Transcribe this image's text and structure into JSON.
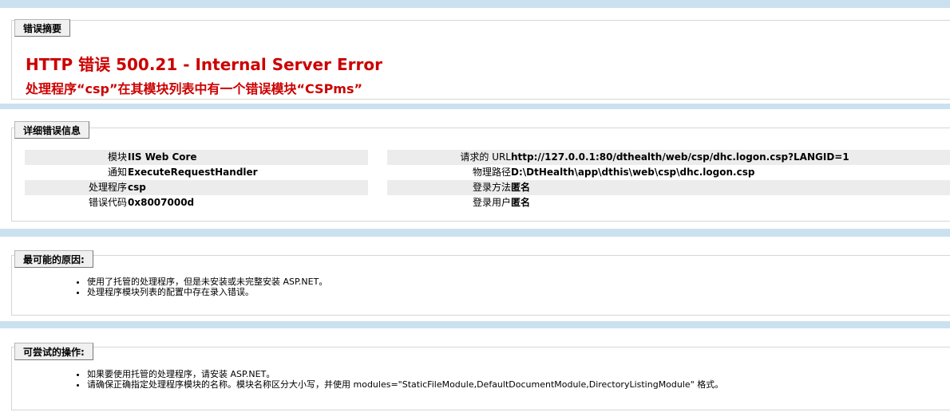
{
  "summary": {
    "legend": "错误摘要",
    "title": "HTTP 错误 500.21 - Internal Server Error",
    "subtitle": "处理程序“csp”在其模块列表中有一个错误模块“CSPms”"
  },
  "details": {
    "legend": "详细错误信息",
    "left": [
      {
        "label": "模块",
        "value": "IIS Web Core"
      },
      {
        "label": "通知",
        "value": "ExecuteRequestHandler"
      },
      {
        "label": "处理程序",
        "value": "csp"
      },
      {
        "label": "错误代码",
        "value": "0x8007000d"
      }
    ],
    "right": [
      {
        "label": "请求的 URL",
        "value": "http://127.0.0.1:80/dthealth/web/csp/dhc.logon.csp?LANGID=1"
      },
      {
        "label": "物理路径",
        "value": "D:\\DtHealth\\app\\dthis\\web\\csp\\dhc.logon.csp"
      },
      {
        "label": "登录方法",
        "value": "匿名"
      },
      {
        "label": "登录用户",
        "value": "匿名"
      }
    ]
  },
  "causes": {
    "legend": "最可能的原因:",
    "items": [
      "使用了托管的处理程序，但是未安装或未完整安装 ASP.NET。",
      "处理程序模块列表的配置中存在录入错误。"
    ]
  },
  "actions": {
    "legend": "可尝试的操作:",
    "items": [
      "如果要使用托管的处理程序，请安装 ASP.NET。",
      "请确保正确指定处理程序模块的名称。模块名称区分大小写，并使用 modules=\"StaticFileModule,DefaultDocumentModule,DirectoryListingModule\" 格式。"
    ]
  },
  "colors": {
    "error_red": "#cc0000",
    "page_bg": "#cbe1ef",
    "row_shade": "#ececec"
  }
}
